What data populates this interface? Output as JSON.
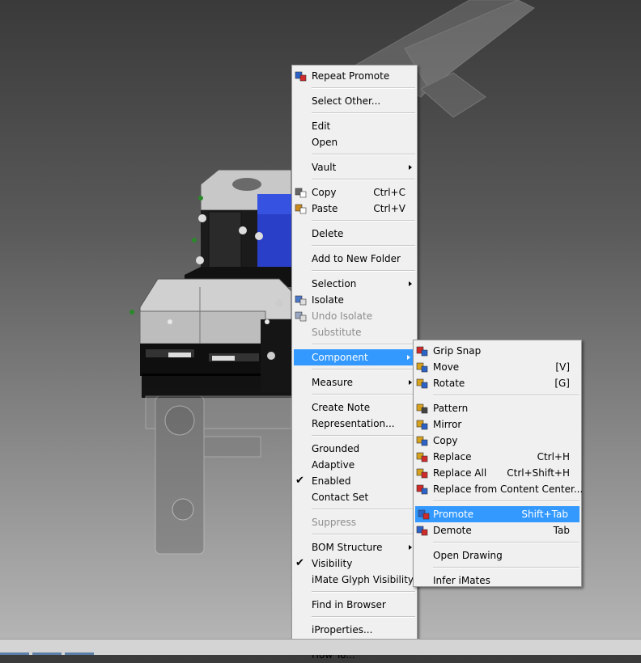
{
  "context_menu": {
    "groups": [
      [
        {
          "label": "Repeat Promote",
          "icon": "repeat-promote-icon"
        }
      ],
      [
        {
          "label": "Select Other..."
        }
      ],
      [
        {
          "label": "Edit"
        },
        {
          "label": "Open"
        }
      ],
      [
        {
          "label": "Vault",
          "submenu": true
        }
      ],
      [
        {
          "label": "Copy",
          "shortcut": "Ctrl+C",
          "icon": "copy-icon"
        },
        {
          "label": "Paste",
          "shortcut": "Ctrl+V",
          "icon": "paste-icon"
        }
      ],
      [
        {
          "label": "Delete"
        }
      ],
      [
        {
          "label": "Add to New Folder"
        }
      ],
      [
        {
          "label": "Selection",
          "submenu": true
        },
        {
          "label": "Isolate",
          "icon": "isolate-icon"
        },
        {
          "label": "Undo Isolate",
          "disabled": true,
          "icon": "undo-isolate-icon"
        },
        {
          "label": "Substitute",
          "disabled": true
        }
      ],
      [
        {
          "label": "Component",
          "submenu": true,
          "highlighted": true
        }
      ],
      [
        {
          "label": "Measure",
          "submenu": true
        }
      ],
      [
        {
          "label": "Create Note"
        },
        {
          "label": "Representation..."
        }
      ],
      [
        {
          "label": "Grounded"
        },
        {
          "label": "Adaptive"
        },
        {
          "label": "Enabled",
          "checked": true
        },
        {
          "label": "Contact Set"
        }
      ],
      [
        {
          "label": "Suppress",
          "disabled": true
        }
      ],
      [
        {
          "label": "BOM Structure",
          "submenu": true
        },
        {
          "label": "Visibility",
          "checked": true
        },
        {
          "label": "iMate Glyph Visibility"
        }
      ],
      [
        {
          "label": "Find in Browser"
        }
      ],
      [
        {
          "label": "iProperties..."
        }
      ],
      [
        {
          "label": "How To..."
        }
      ]
    ]
  },
  "component_submenu": {
    "groups": [
      [
        {
          "label": "Grip Snap",
          "icon": "grip-snap-icon"
        },
        {
          "label": "Move",
          "shortcut": "[V]",
          "icon": "move-icon"
        },
        {
          "label": "Rotate",
          "shortcut": "[G]",
          "icon": "rotate-icon"
        }
      ],
      [
        {
          "label": "Pattern",
          "icon": "pattern-icon"
        },
        {
          "label": "Mirror",
          "icon": "mirror-icon"
        },
        {
          "label": "Copy",
          "icon": "copy-component-icon"
        },
        {
          "label": "Replace",
          "shortcut": "Ctrl+H",
          "icon": "replace-icon"
        },
        {
          "label": "Replace All",
          "shortcut": "Ctrl+Shift+H",
          "icon": "replace-all-icon"
        },
        {
          "label": "Replace from Content Center...",
          "icon": "content-center-icon"
        }
      ],
      [
        {
          "label": "Promote",
          "shortcut": "Shift+Tab",
          "highlighted": true,
          "icon": "promote-icon"
        },
        {
          "label": "Demote",
          "shortcut": "Tab",
          "icon": "demote-icon"
        }
      ],
      [
        {
          "label": "Open Drawing"
        }
      ],
      [
        {
          "label": "Infer iMates"
        }
      ]
    ]
  },
  "colors": {
    "highlight": "#3399ff",
    "menu_bg": "#f0f0f0",
    "selected_part": "#2a3fc8"
  }
}
